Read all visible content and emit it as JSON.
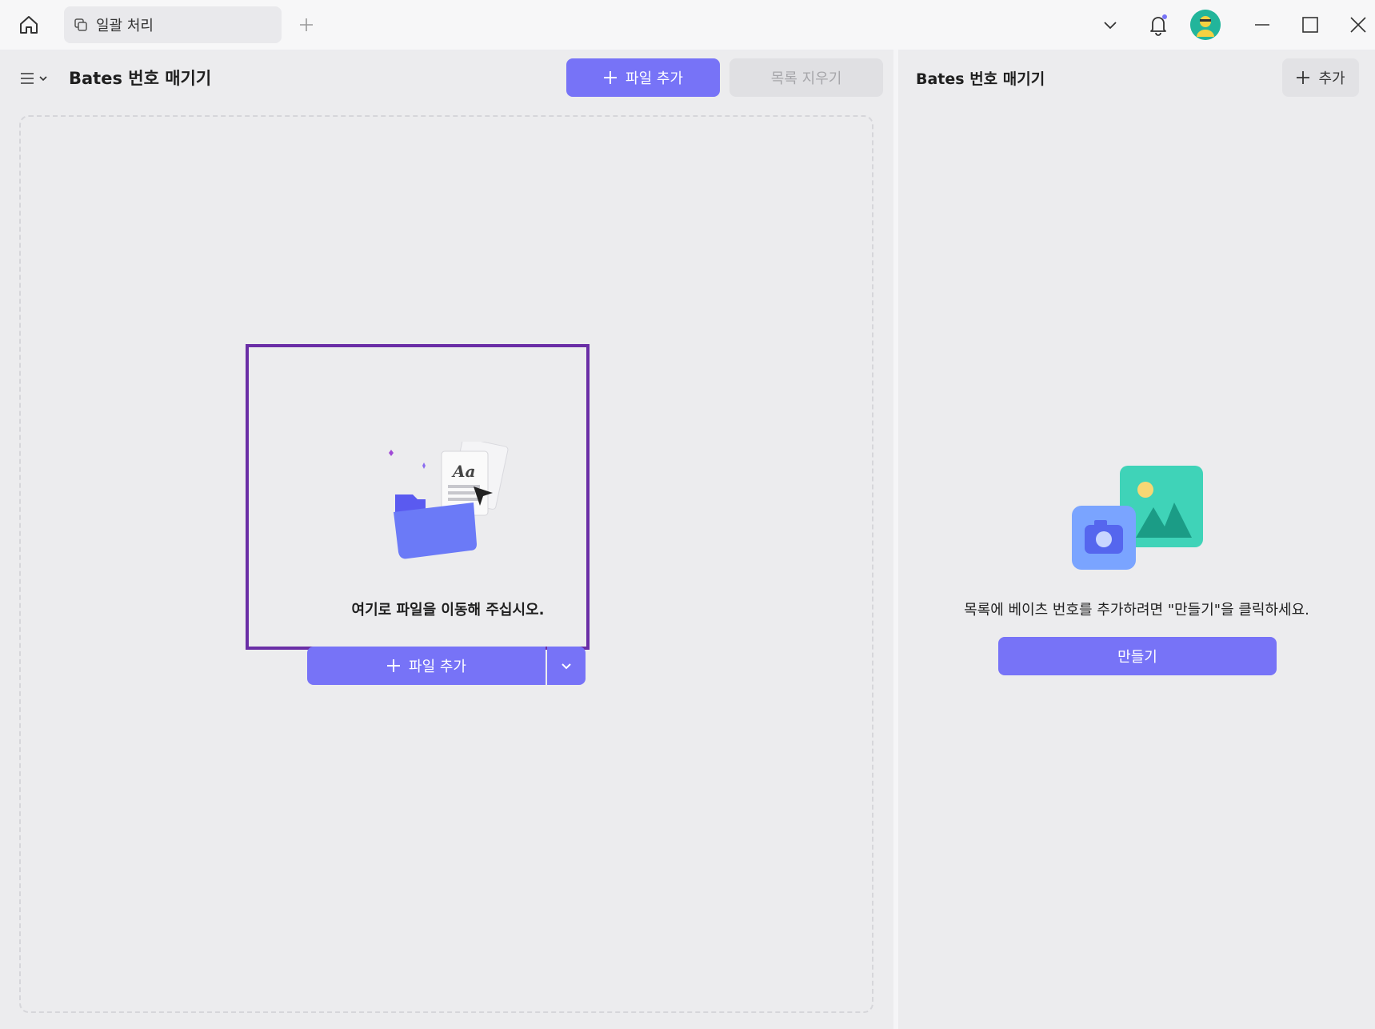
{
  "titlebar": {
    "tab_label": "일괄 처리",
    "icons": [
      "home-icon",
      "tab-batch-icon",
      "plus-icon",
      "chevron-down-icon",
      "bell-icon",
      "avatar",
      "minimize-icon",
      "maximize-icon",
      "close-icon"
    ]
  },
  "left": {
    "title": "Bates 번호 매기기",
    "add_file_label": "파일 추가",
    "clear_list_label": "목록 지우기",
    "drop_text": "여기로 파일을 이동해 주십시오.",
    "split_add_label": "파일 추가",
    "illustration_text": "Aa"
  },
  "right": {
    "title": "Bates 번호 매기기",
    "add_label": "추가",
    "hint_text": "목록에 베이츠 번호를 추가하려면 \"만들기\"을 클릭하세요.",
    "create_label": "만들기"
  },
  "colors": {
    "accent": "#7773f7",
    "highlight": "#6a2ea6",
    "panel_bg": "#ececee"
  }
}
